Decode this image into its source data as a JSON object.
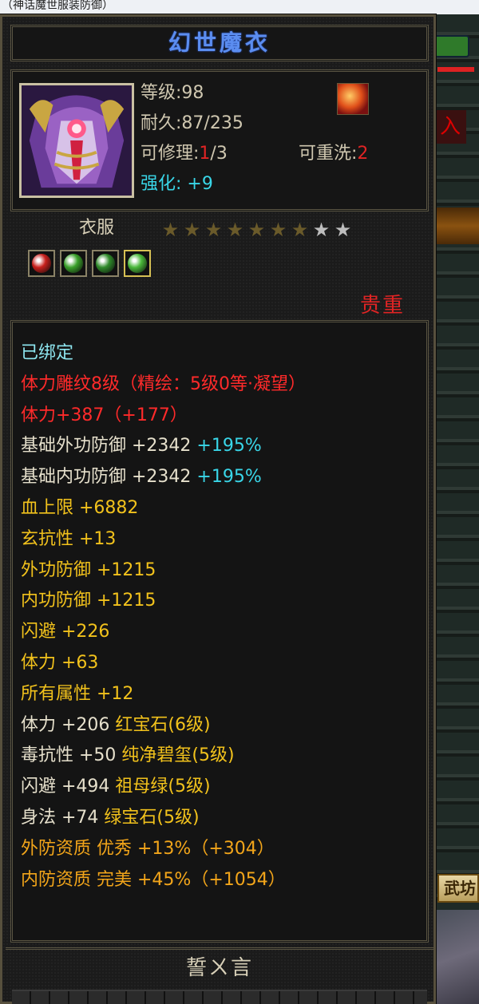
{
  "topbar": {
    "text": "（神话魔世服装防御）"
  },
  "game": {
    "kanji": "入",
    "button": "武坊"
  },
  "item": {
    "name": "幻世魔衣",
    "level_label": "等级:",
    "level_value": "98",
    "durability_label": "耐久:",
    "durability_value": "87/235",
    "repair_label": "可修理:",
    "repair_used": "1",
    "repair_total": "/3",
    "rewash_label": "可重洗:",
    "rewash_value": "2",
    "enhance_label": "强化: ",
    "enhance_value": "+9",
    "type": "衣服",
    "stars_total": 9,
    "stars_gold": 7,
    "rarity": "贵重",
    "gems": [
      {
        "color": "#c8201c"
      },
      {
        "color": "#3aa02a"
      },
      {
        "color": "#2f8a2a"
      },
      {
        "color": "#4ab83a"
      }
    ]
  },
  "attributes": [
    {
      "text": "已绑定",
      "color": "cyan"
    },
    {
      "text": "体力雕纹8级（精绘：5级0等·凝望）",
      "color": "red"
    },
    {
      "text": "体力+387（+177）",
      "color": "red"
    },
    {
      "text": "基础外功防御 +2342",
      "extra": " +195%",
      "color": "white"
    },
    {
      "text": "基础内功防御 +2342",
      "extra": " +195%",
      "color": "white"
    },
    {
      "text": "血上限 +6882",
      "color": "yellow"
    },
    {
      "text": "玄抗性 +13",
      "color": "yellow"
    },
    {
      "text": "外功防御 +1215",
      "color": "yellow"
    },
    {
      "text": "内功防御 +1215",
      "color": "yellow"
    },
    {
      "text": "闪避 +226",
      "color": "yellow"
    },
    {
      "text": "体力 +63",
      "color": "yellow"
    },
    {
      "text": "所有属性 +12",
      "color": "yellow"
    },
    {
      "text": "体力 +206",
      "extra": " 红宝石(6级)",
      "color": "white"
    },
    {
      "text": "毒抗性 +50",
      "extra": " 纯净碧玺(5级)",
      "color": "white"
    },
    {
      "text": "闪避 +494",
      "extra": " 祖母绿(5级)",
      "color": "white"
    },
    {
      "text": "身法 +74",
      "extra": " 绿宝石(5级)",
      "color": "white"
    },
    {
      "text": "外防资质  优秀 +13%（+304）",
      "color": "orange"
    },
    {
      "text": "内防资质  完美 +45%（+1054）",
      "color": "orange"
    }
  ],
  "footer": {
    "title": "誓ㄨ言"
  },
  "colors": {
    "title_blue": "#5b8df0",
    "red": "#e02424",
    "cyan": "#39d6e8",
    "yellow": "#f2c21c",
    "orange": "#f2a51a",
    "star_gold": "#6a5a2a",
    "star_silver": "#bdbdbd"
  }
}
